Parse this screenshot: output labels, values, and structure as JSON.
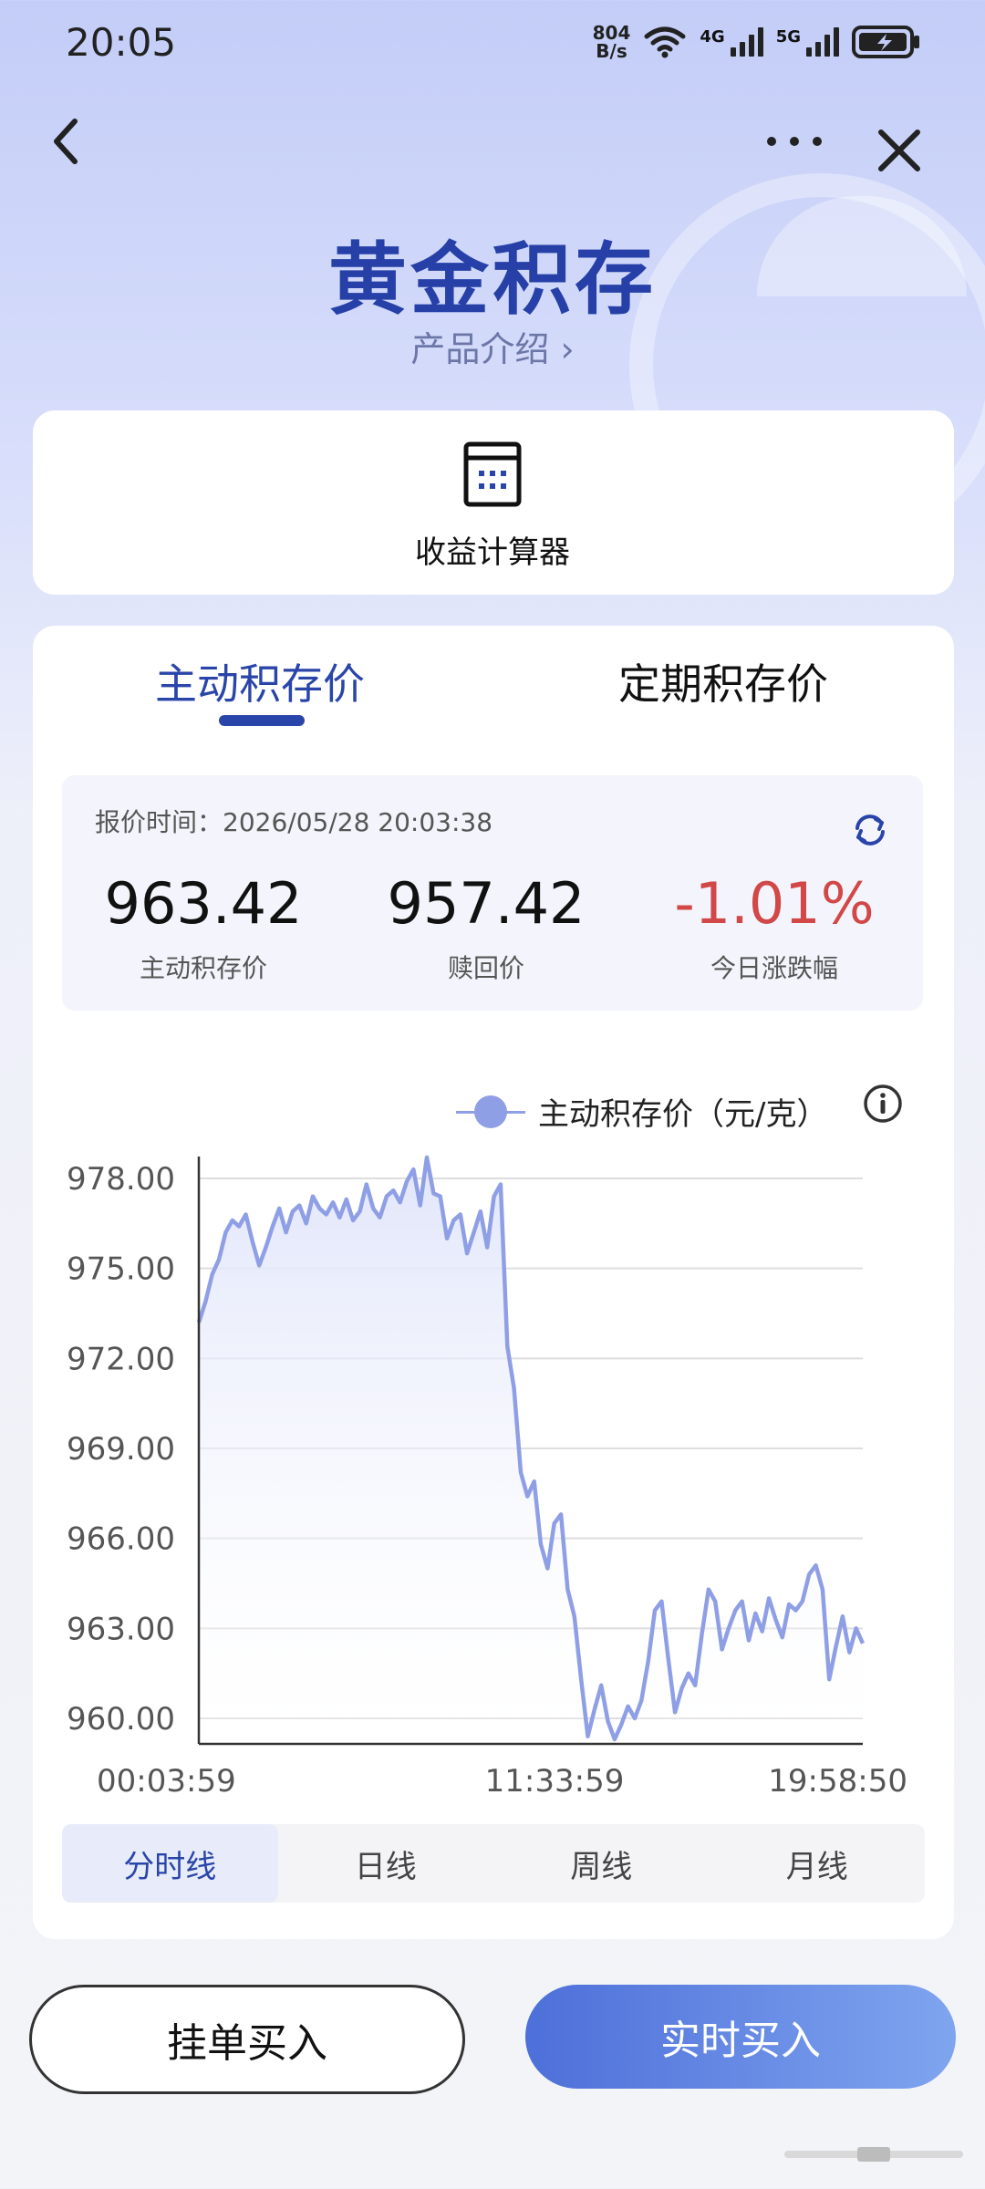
{
  "status_bar": {
    "time": "20:05",
    "net_speed_value": "804",
    "net_speed_unit": "B/s",
    "signal1_label": "4G",
    "signal2_label": "5G",
    "icons": [
      "wifi-icon",
      "signal-4g-icon",
      "signal-5g-icon",
      "battery-charging-icon"
    ]
  },
  "header": {
    "title": "黄金积存",
    "subtitle": "产品介绍 ›"
  },
  "calculator": {
    "label": "收益计算器"
  },
  "tabs": [
    {
      "label": "主动积存价",
      "active": true
    },
    {
      "label": "定期积存价",
      "active": false
    }
  ],
  "quote": {
    "time_label": "报价时间：",
    "time_value": "2026/05/28 20:03:38",
    "items": [
      {
        "value": "963.42",
        "label": "主动积存价"
      },
      {
        "value": "957.42",
        "label": "赎回价"
      },
      {
        "value": "-1.01%",
        "label": "今日涨跌幅"
      }
    ],
    "negative_color": "#d24848"
  },
  "chart_data": {
    "type": "area",
    "series": [
      {
        "name": "主动积存价（元/克）",
        "color": "#8f9fe6",
        "values": [
          973.2,
          973.9,
          974.8,
          975.3,
          976.2,
          976.6,
          976.4,
          976.8,
          975.9,
          975.1,
          975.7,
          976.4,
          977.0,
          976.2,
          976.9,
          977.1,
          976.5,
          977.4,
          977.0,
          976.8,
          977.2,
          976.7,
          977.3,
          976.6,
          976.9,
          977.8,
          977.0,
          976.7,
          977.4,
          977.6,
          977.2,
          977.9,
          978.3,
          977.1,
          978.7,
          977.5,
          977.4,
          976.0,
          976.6,
          976.8,
          975.5,
          976.2,
          976.9,
          975.7,
          977.4,
          977.8,
          972.4,
          971.0,
          968.2,
          967.4,
          967.9,
          965.8,
          965.0,
          966.5,
          966.8,
          964.3,
          963.4,
          961.3,
          959.4,
          960.3,
          961.1,
          959.9,
          959.3,
          959.8,
          960.4,
          960.0,
          960.6,
          961.9,
          963.6,
          963.9,
          962.0,
          960.2,
          961.0,
          961.5,
          961.1,
          962.8,
          964.3,
          963.9,
          962.3,
          963.0,
          963.6,
          963.9,
          962.6,
          963.5,
          962.9,
          964.0,
          963.3,
          962.7,
          963.8,
          963.6,
          963.9,
          964.8,
          965.1,
          964.3,
          961.3,
          962.4,
          963.4,
          962.2,
          963.0,
          962.5
        ]
      }
    ],
    "x_tick_labels": [
      "00:03:59",
      "11:33:59",
      "19:58:50"
    ],
    "y_tick_labels": [
      "978.00",
      "975.00",
      "972.00",
      "969.00",
      "966.00",
      "963.00",
      "960.00"
    ],
    "ylim": [
      960,
      978
    ],
    "y_axis_min": 959.2,
    "grid": true,
    "legend": "top-right",
    "title": "",
    "xlabel": "",
    "ylabel": ""
  },
  "period_tabs": [
    {
      "label": "分时线",
      "active": true
    },
    {
      "label": "日线",
      "active": false
    },
    {
      "label": "周线",
      "active": false
    },
    {
      "label": "月线",
      "active": false
    }
  ],
  "actions": {
    "limit_buy": "挂单买入",
    "instant_buy": "实时买入"
  },
  "colors": {
    "accent": "#2a45a9",
    "line": "#8f9fe6",
    "buy_gradient_start": "#4d6fd9",
    "buy_gradient_end": "#7fa5ef"
  }
}
